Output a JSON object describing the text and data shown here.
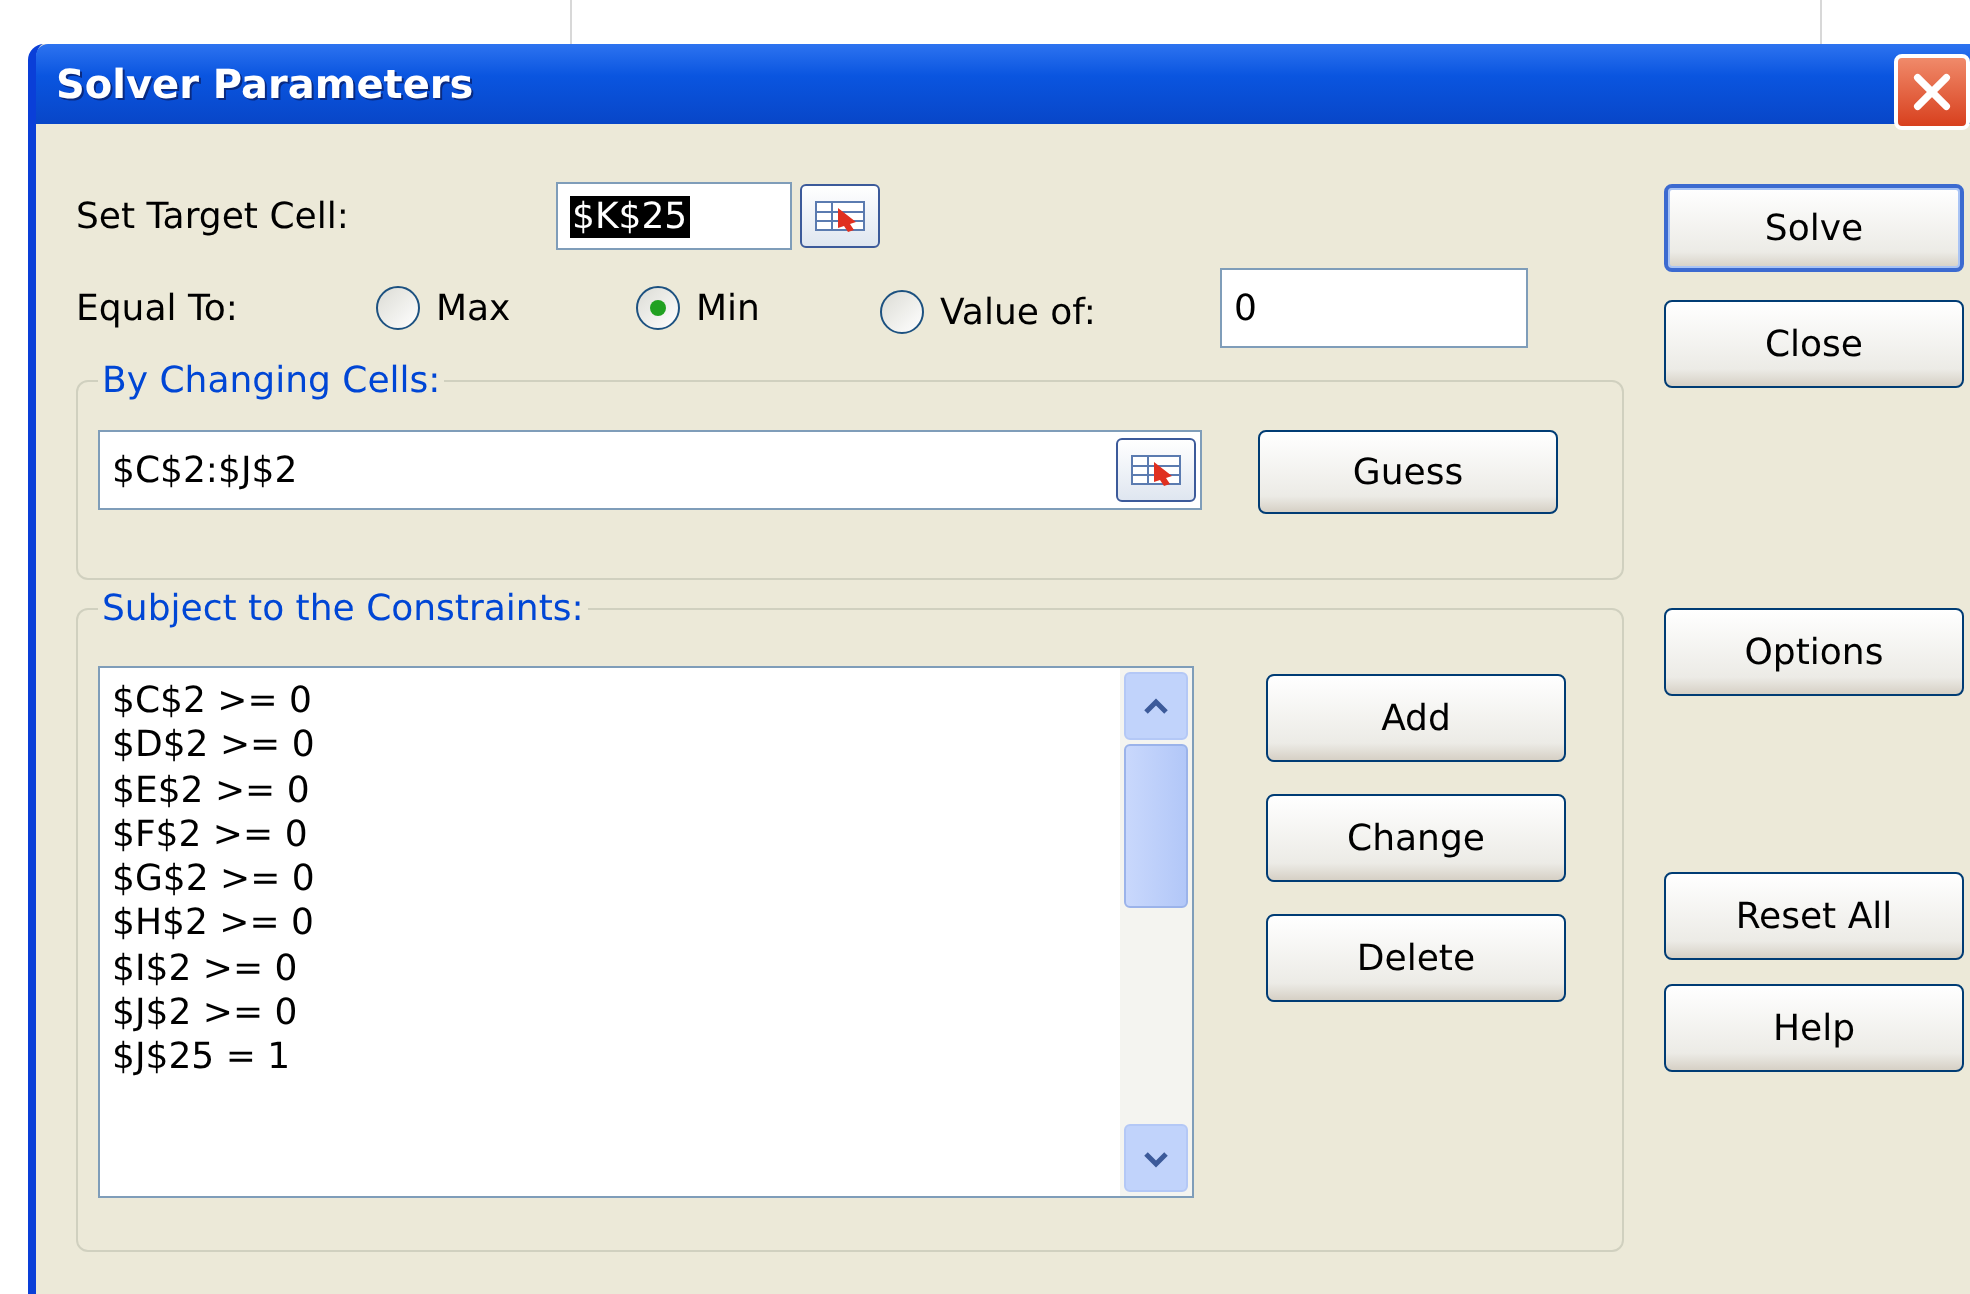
{
  "window": {
    "title": "Solver Parameters"
  },
  "target_cell": {
    "label": "Set Target Cell:",
    "value": "$K$25",
    "text_selected": true
  },
  "equal_to": {
    "label": "Equal To:",
    "options": [
      {
        "label": "Max",
        "selected": false
      },
      {
        "label": "Min",
        "selected": true
      },
      {
        "label": "Value of:",
        "selected": false
      }
    ],
    "value": "0"
  },
  "changing_cells": {
    "label": "By Changing Cells:",
    "value": "$C$2:$J$2",
    "button": "Guess"
  },
  "constraints": {
    "label": "Subject to the Constraints:",
    "items": [
      "$C$2 >= 0",
      "$D$2 >= 0",
      "$E$2 >= 0",
      "$F$2 >= 0",
      "$G$2 >= 0",
      "$H$2 >= 0",
      "$I$2 >= 0",
      "$J$2 >= 0",
      "$J$25 = 1"
    ],
    "buttons": [
      "Add",
      "Change",
      "Delete"
    ]
  },
  "side_buttons": [
    {
      "label": "Solve",
      "default": true
    },
    {
      "label": "Close",
      "default": false
    },
    {
      "label": "Options",
      "default": false
    },
    {
      "label": "Reset All",
      "default": false
    },
    {
      "label": "Help",
      "default": false
    }
  ]
}
